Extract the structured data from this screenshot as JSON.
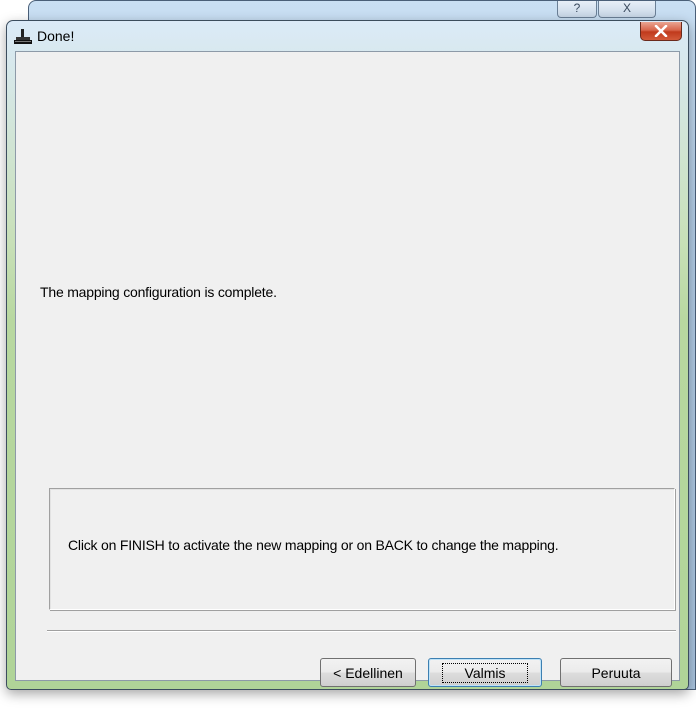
{
  "dialog": {
    "title": "Done!",
    "icon": "bucket-pour-icon"
  },
  "main": {
    "message": "The mapping configuration is complete."
  },
  "info": {
    "text": "Click on FINISH to activate the new mapping or on BACK to change the mapping."
  },
  "buttons": {
    "back_label": "< Edellinen",
    "finish_label": "Valmis",
    "cancel_label": "Peruuta"
  },
  "parent_window": {
    "help_glyph": "?",
    "close_glyph": "X"
  },
  "colors": {
    "close_button": "#c8452a",
    "client_bg": "#f0f0f0",
    "default_button_border": "#3c7fb1"
  }
}
